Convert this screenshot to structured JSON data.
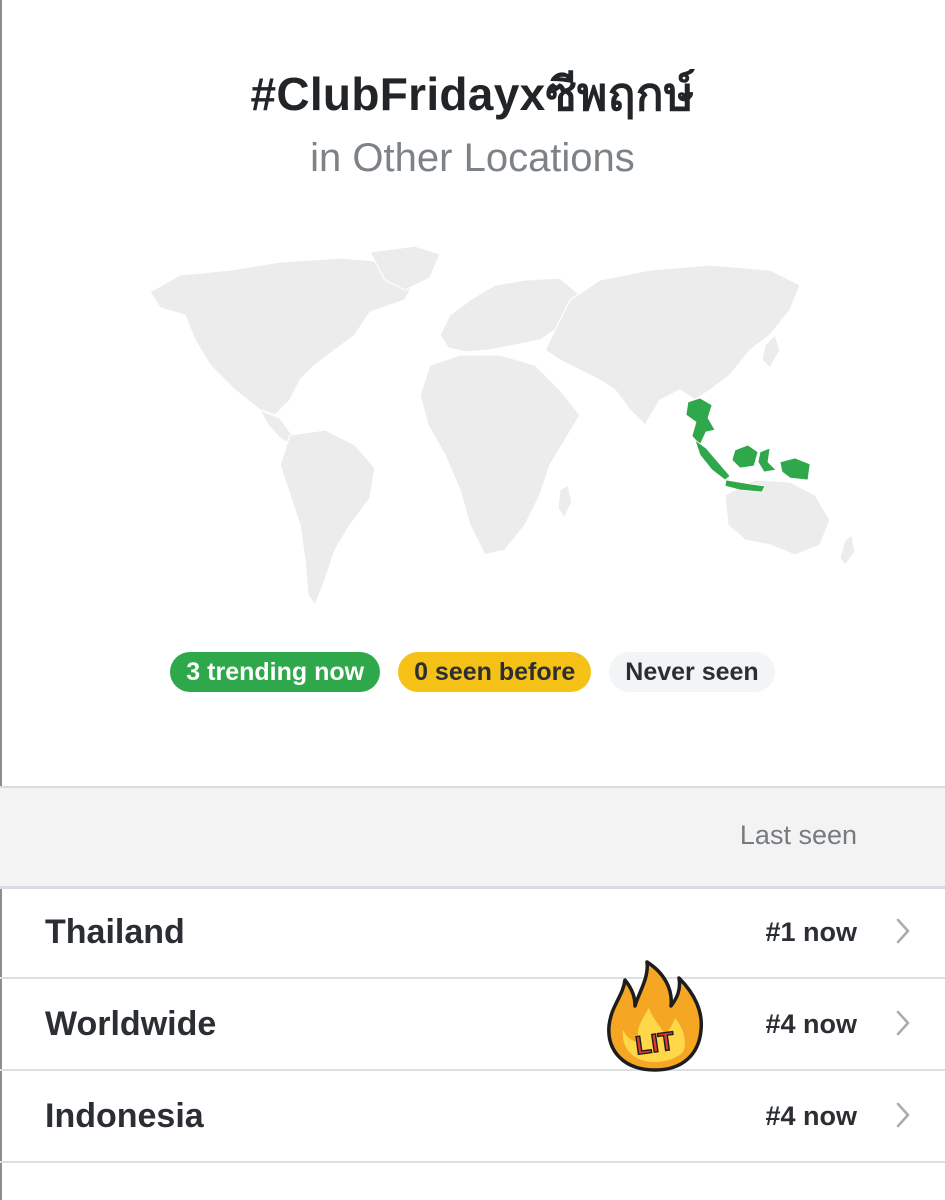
{
  "header": {
    "title": "#ClubFridayxซีพฤกษ์",
    "subtitle": "in Other Locations"
  },
  "map": {
    "land_color": "#ececec",
    "highlight_color": "#2ea84a",
    "highlighted_countries": [
      "Thailand",
      "Indonesia"
    ]
  },
  "legend": {
    "trending": "3 trending now",
    "seen_before": "0 seen before",
    "never_seen": "Never seen"
  },
  "table": {
    "header_label": "Last seen",
    "rows": [
      {
        "name": "Thailand",
        "rank": "#1 now"
      },
      {
        "name": "Worldwide",
        "rank": "#4 now"
      },
      {
        "name": "Indonesia",
        "rank": "#4 now"
      }
    ]
  },
  "sticker": {
    "text": "LIT"
  },
  "colors": {
    "green": "#2ea84a",
    "yellow": "#f6c117",
    "grey_pill": "#f3f4f6",
    "flame_orange": "#f5a623"
  }
}
